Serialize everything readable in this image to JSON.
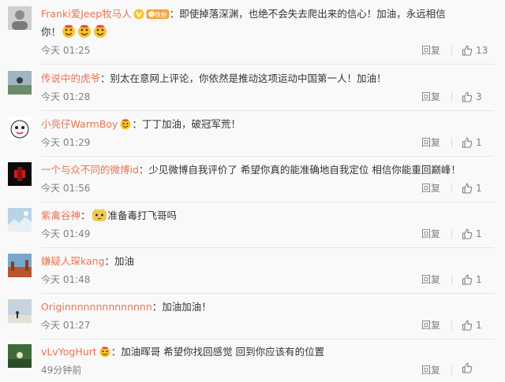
{
  "comments": [
    {
      "username": "Franki爱Jeep牧马人",
      "has_v_badge": true,
      "has_fan_badge": true,
      "fan_badge_label": "铁粉",
      "text_line1": "：即使掉落深渊，也绝不会失去爬出来的信心！加油，永远相信",
      "text_line2": "你！",
      "emoticons_after": 3,
      "time": "今天 01:25",
      "reply_label": "回复",
      "likes": "13"
    },
    {
      "username": "传说中的虎爷",
      "text": "：别太在意网上评论，你依然是推动这项运动中国第一人！加油！",
      "time": "今天 01:28",
      "reply_label": "回复",
      "likes": "3"
    },
    {
      "username": "小亮仔WarmBoy",
      "text": "：丁丁加油，破冠军荒！",
      "time": "今天 01:29",
      "reply_label": "回复",
      "likes": "1"
    },
    {
      "username": "一个与众不同的微博id",
      "text": "：少见微博自我评价了 希望你真的能准确地自我定位 相信你能重回巅峰！",
      "time": "今天 01:56",
      "reply_label": "回复",
      "likes": "1"
    },
    {
      "username": "紫禽谷神",
      "text": "准备毒打飞哥吗",
      "time": "今天 01:49",
      "reply_label": "回复",
      "likes": "1"
    },
    {
      "username": "嫌疑人琛kang",
      "text": "：加油",
      "time": "今天 01:48",
      "reply_label": "回复",
      "likes": "1"
    },
    {
      "username": "Originnnnnnnnnnnnnn",
      "text": "：加油加油！",
      "time": "今天 01:27",
      "reply_label": "回复",
      "likes": "1"
    },
    {
      "username": "vLvYogHurt",
      "text": "：加油晖哥 希望你找回感觉 回到你应该有的位置",
      "time": "49分钟前",
      "reply_label": "回复",
      "likes": ""
    }
  ],
  "colors": {
    "username": "#eb7350",
    "text": "#333333",
    "meta": "#808080",
    "divider": "#e6e6e6",
    "emoji_yellow": "#f7c52a"
  },
  "icons": {
    "like": "thumbs-up-icon",
    "verified": "v-badge-icon",
    "fan": "fan-badge-icon",
    "emoji": "emoji-face-icon"
  }
}
